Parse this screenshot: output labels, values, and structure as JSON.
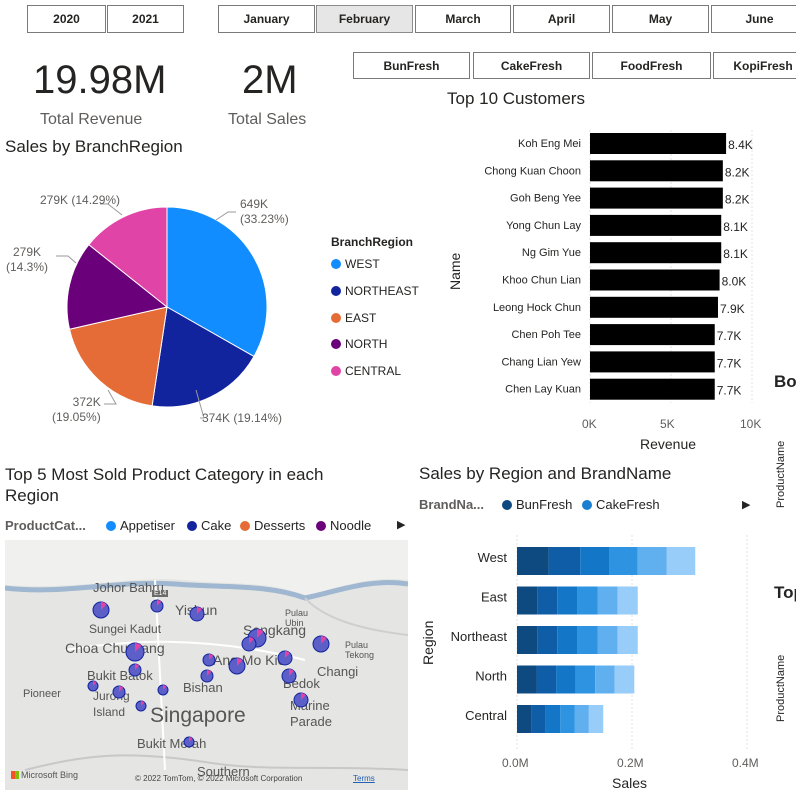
{
  "year_slicer": [
    "2020",
    "2021"
  ],
  "month_slicer": {
    "items": [
      "January",
      "February",
      "March",
      "April",
      "May",
      "June"
    ],
    "selected": "February"
  },
  "brand_slicer": [
    "BunFresh",
    "CakeFresh",
    "FoodFresh",
    "KopiFresh"
  ],
  "kpis": [
    {
      "value": "19.98M",
      "label": "Total Revenue"
    },
    {
      "value": "2M",
      "label": "Total Sales"
    }
  ],
  "pie": {
    "title": "Sales by BranchRegion",
    "legend_title": "BranchRegion",
    "slices": [
      {
        "name": "WEST",
        "label": "649K\n(33.23%)",
        "color": "#118dff"
      },
      {
        "name": "NORTHEAST",
        "label": "374K (19.14%)",
        "color": "#12239e"
      },
      {
        "name": "EAST",
        "label": "372K\n(19.05%)",
        "color": "#e66c37"
      },
      {
        "name": "NORTH",
        "label": "279K\n(14.3%)",
        "color": "#6b007b"
      },
      {
        "name": "CENTRAL",
        "label": "279K (14.29%)",
        "color": "#e044a7"
      }
    ]
  },
  "top_customers": {
    "title": "Top 10 Customers",
    "ylabel": "Name",
    "xlabel": "Revenue",
    "xticks": [
      "0K",
      "5K",
      "10K"
    ],
    "bar_color": "#000000"
  },
  "map": {
    "title": "Top 5 Most Sold Product Category in each Region",
    "legend_title": "ProductCat...",
    "legend": [
      {
        "name": "Appetiser",
        "color": "#118dff"
      },
      {
        "name": "Cake",
        "color": "#12239e"
      },
      {
        "name": "Desserts",
        "color": "#e66c37"
      },
      {
        "name": "Noodle",
        "color": "#6b007b"
      }
    ],
    "places": [
      "Johor Bahru",
      "Sungei Kadut",
      "Yishun",
      "Sengkang",
      "Pulau Ubin",
      "Choa Chu Kang",
      "Pulau Tekong",
      "Ang Mo Kio",
      "Bukit Batok",
      "Changi",
      "Bishan",
      "Bedok",
      "Pioneer",
      "Jurong Island",
      "Singapore",
      "Marine Parade",
      "Bukit Merah",
      "Southern"
    ],
    "road": "E14",
    "logo": "Microsoft Bing",
    "copyright": "© 2022 TomTom, © 2022 Microsoft Corporation",
    "terms": "Terms"
  },
  "region_brand": {
    "title": "Sales by Region and BrandName",
    "legend_title": "BrandNa...",
    "legend": [
      {
        "name": "BunFresh",
        "color": "#0e4a80"
      },
      {
        "name": "CakeFresh",
        "color": "#1a7fd0"
      }
    ],
    "ylabel": "Region",
    "xlabel": "Sales",
    "xticks": [
      "0.0M",
      "0.2M",
      "0.4M"
    ],
    "shades": [
      "#0e4a80",
      "#0f5da6",
      "#1476c6",
      "#2e93e0",
      "#60b0ef",
      "#97cdf8"
    ]
  },
  "cut_off": {
    "title_a": "Bo",
    "title_b": "Top",
    "axis_label": "ProductName"
  },
  "chart_data": [
    {
      "type": "pie",
      "title": "Sales by BranchRegion",
      "categories": [
        "WEST",
        "NORTHEAST",
        "EAST",
        "NORTH",
        "CENTRAL"
      ],
      "values": [
        649,
        374,
        372,
        279,
        279
      ],
      "percent": [
        33.23,
        19.14,
        19.05,
        14.3,
        14.29
      ],
      "legend": "right"
    },
    {
      "type": "bar",
      "orientation": "horizontal",
      "title": "Top 10 Customers",
      "xlabel": "Revenue",
      "ylabel": "Name",
      "categories": [
        "Koh Eng Mei",
        "Chong Kuan Choon",
        "Goh Beng Yee",
        "Yong Chun Lay",
        "Ng Gim Yue",
        "Khoo Chun Lian",
        "Leong Hock Chun",
        "Chen Poh Tee",
        "Chang Lian Yew",
        "Chen Lay Kuan"
      ],
      "values": [
        8.4,
        8.2,
        8.2,
        8.1,
        8.1,
        8.0,
        7.9,
        7.7,
        7.7,
        7.7
      ],
      "data_labels": [
        "8.4K",
        "8.2K",
        "8.2K",
        "8.1K",
        "8.1K",
        "8.0K",
        "7.9K",
        "7.7K",
        "7.7K",
        "7.7K"
      ],
      "xlim": [
        0,
        10
      ]
    },
    {
      "type": "bar",
      "orientation": "horizontal",
      "stacked": true,
      "title": "Sales by Region and BrandName",
      "xlabel": "Sales",
      "ylabel": "Region",
      "categories": [
        "West",
        "East",
        "Northeast",
        "North",
        "Central"
      ],
      "segments": [
        [
          0.055,
          0.055,
          0.05,
          0.05,
          0.05,
          0.05
        ],
        [
          0.035,
          0.035,
          0.035,
          0.035,
          0.035,
          0.035
        ],
        [
          0.035,
          0.035,
          0.035,
          0.035,
          0.035,
          0.035
        ],
        [
          0.034,
          0.034,
          0.034,
          0.034,
          0.034,
          0.034
        ],
        [
          0.025,
          0.025,
          0.025,
          0.025,
          0.025,
          0.025
        ]
      ],
      "xlim": [
        0,
        0.4
      ]
    }
  ]
}
